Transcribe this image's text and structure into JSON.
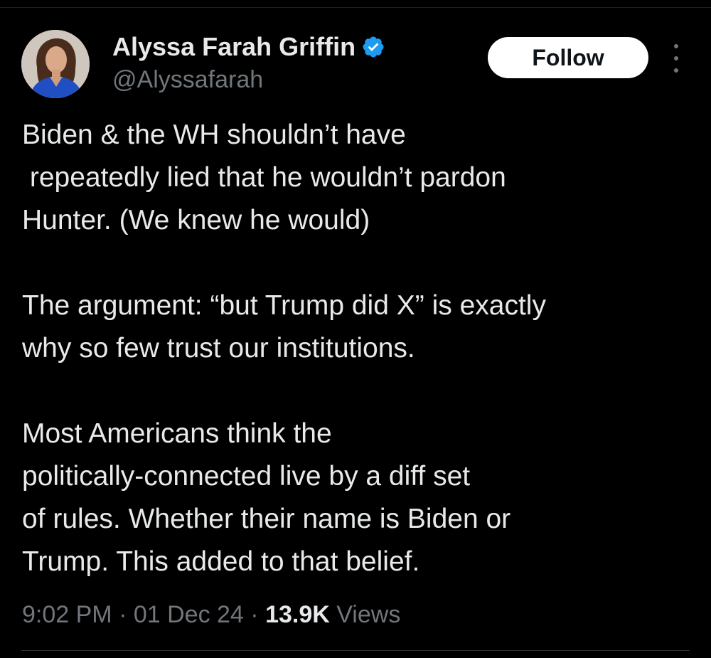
{
  "author": {
    "display_name": "Alyssa Farah Griffin",
    "handle": "@Alyssafarah",
    "verified": true,
    "verified_color": "#1d9bf0"
  },
  "actions": {
    "follow_label": "Follow",
    "more_icon": "more-vertical-icon"
  },
  "tweet": {
    "paragraphs": [
      {
        "lines": [
          "Biden & the WH shouldn’t have",
          " repeatedly lied that he wouldn’t pardon",
          "Hunter. (We knew he would)"
        ]
      },
      {
        "lines": [
          "The argument: “but Trump did X” is exactly",
          "why so few trust our institutions."
        ]
      },
      {
        "lines": [
          "Most Americans think the",
          "politically-connected live by a diff set",
          "of rules. Whether their name is Biden or",
          "Trump. This added to that belief."
        ]
      }
    ]
  },
  "meta": {
    "time": "9:02 PM",
    "separator": " · ",
    "date": "01 Dec 24",
    "views_count": "13.9K",
    "views_label": " Views"
  },
  "colors": {
    "background": "#000000",
    "text_primary": "#e7e9ea",
    "text_secondary": "#71767b",
    "follow_bg": "#ffffff"
  }
}
